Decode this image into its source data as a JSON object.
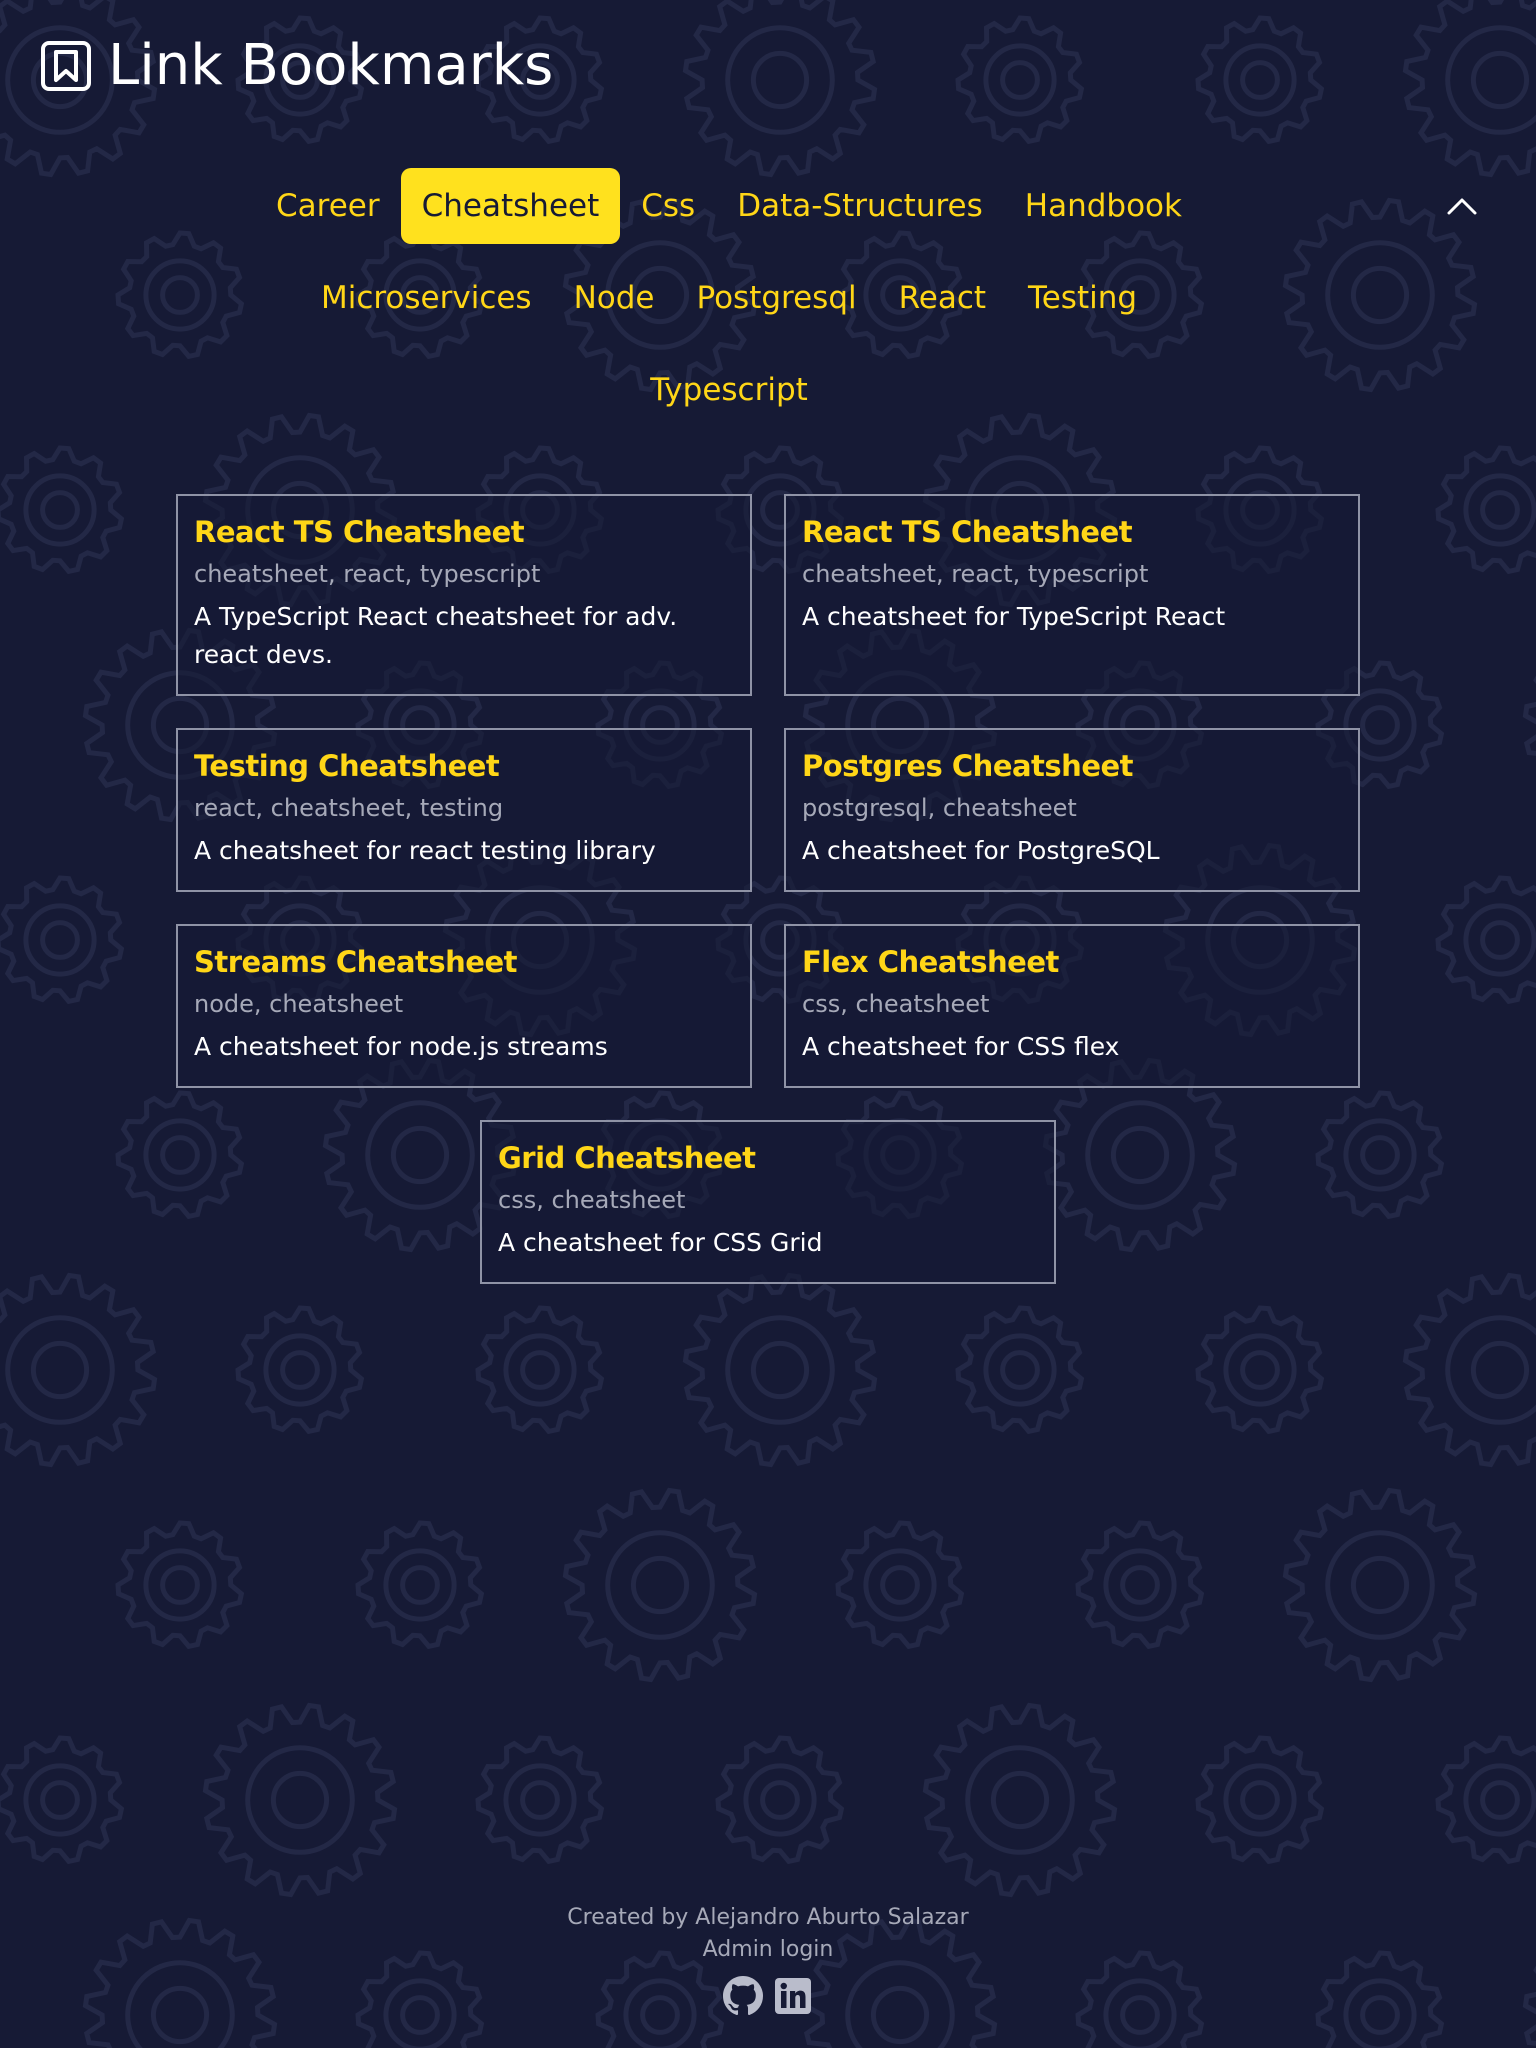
{
  "header": {
    "title": "Link Bookmarks",
    "logo_icon": "bookmark-icon"
  },
  "colors": {
    "background": "#161a35",
    "accent": "#ffd617",
    "active_tag_bg": "#ffe11e",
    "card_border": "#8f93a6",
    "muted_text": "#a6a9b8"
  },
  "nav": {
    "collapse_icon": "chevron-up-icon",
    "rows": [
      [
        {
          "label": "Career",
          "active": false
        },
        {
          "label": "Cheatsheet",
          "active": true
        },
        {
          "label": "Css",
          "active": false
        },
        {
          "label": "Data-Structures",
          "active": false
        },
        {
          "label": "Handbook",
          "active": false
        }
      ],
      [
        {
          "label": "Microservices",
          "active": false
        },
        {
          "label": "Node",
          "active": false
        },
        {
          "label": "Postgresql",
          "active": false
        },
        {
          "label": "React",
          "active": false
        },
        {
          "label": "Testing",
          "active": false
        }
      ],
      [
        {
          "label": "Typescript",
          "active": false
        }
      ]
    ]
  },
  "cards": [
    {
      "title": "React TS Cheatsheet",
      "tags": "cheatsheet, react, typescript",
      "description": "A TypeScript React cheatsheet for adv. react devs."
    },
    {
      "title": "React TS Cheatsheet",
      "tags": "cheatsheet, react, typescript",
      "description": "A cheatsheet for TypeScript React"
    },
    {
      "title": "Testing Cheatsheet",
      "tags": "react, cheatsheet, testing",
      "description": "A cheatsheet for react testing library"
    },
    {
      "title": "Postgres Cheatsheet",
      "tags": "postgresql, cheatsheet",
      "description": "A cheatsheet for PostgreSQL"
    },
    {
      "title": "Streams Cheatsheet",
      "tags": "node, cheatsheet",
      "description": "A cheatsheet for node.js streams"
    },
    {
      "title": "Flex Cheatsheet",
      "tags": "css, cheatsheet",
      "description": "A cheatsheet for CSS flex"
    },
    {
      "title": "Grid Cheatsheet",
      "tags": "css, cheatsheet",
      "description": "A cheatsheet for CSS Grid"
    }
  ],
  "footer": {
    "credit": "Created by Alejandro Aburto Salazar",
    "admin_login": "Admin login",
    "social_icons": [
      "github-icon",
      "linkedin-icon"
    ]
  }
}
